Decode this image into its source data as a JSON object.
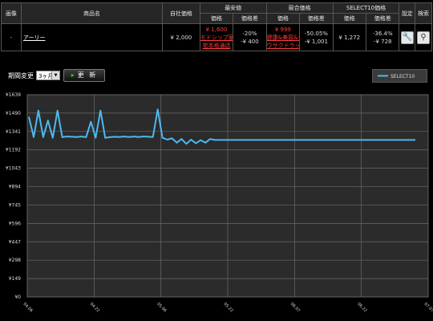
{
  "table": {
    "headers": {
      "image": "画像",
      "product": "商品名",
      "own_price": "自社価格",
      "lowest": "最安値",
      "competitor": "競合価格",
      "select10": "SELECT10価格",
      "settings": "設定",
      "search": "検索",
      "price": "価格",
      "price_diff": "価格差"
    },
    "row": {
      "image": "-",
      "product_name": "アーリー",
      "own_price": "¥ 2,000",
      "lowest_price": "¥ 1,600",
      "lowest_shop": "モドシップ家",
      "lowest_shop2": "宅本格通店",
      "lowest_diff_pct": "-20%",
      "lowest_diff_amt": "-¥ 400",
      "comp_price": "¥ 999",
      "comp_shop": "健康&美容&サ",
      "comp_shop2": "ウサクドラッグ",
      "comp_diff_pct": "-50.05%",
      "comp_diff_amt": "-¥ 1,001",
      "s10_price": "¥ 1,272",
      "s10_diff_pct": "-36.4%",
      "s10_diff_amt": "-¥ 728",
      "settings_icon": "wrench-icon",
      "search_icon": "magnifier-icon"
    }
  },
  "period": {
    "label": "期間変更",
    "selected": "3ヶ月",
    "update_label": "更 新"
  },
  "chart_data": {
    "type": "line",
    "y_ticks": [
      "¥1639",
      "¥1490",
      "¥1341",
      "¥1192",
      "¥1043",
      "¥894",
      "¥745",
      "¥596",
      "¥447",
      "¥298",
      "¥149",
      "¥0"
    ],
    "ylim": [
      0,
      1639
    ],
    "x_ticks": [
      "04.06",
      "04.22",
      "05.06",
      "05.22",
      "06.07",
      "06.22",
      "07.07"
    ],
    "legend": "SELECT10",
    "series": [
      {
        "name": "SELECT10",
        "color": "#4db8f0",
        "values": [
          1460,
          1295,
          1510,
          1295,
          1430,
          1290,
          1510,
          1295,
          1300,
          1298,
          1296,
          1300,
          1295,
          1420,
          1290,
          1510,
          1290,
          1295,
          1298,
          1296,
          1300,
          1296,
          1300,
          1296,
          1300,
          1298,
          1296,
          1520,
          1290,
          1275,
          1285,
          1250,
          1280,
          1240,
          1275,
          1245,
          1270,
          1250,
          1280,
          1272,
          1272,
          1272,
          1272,
          1272,
          1272,
          1272,
          1272,
          1272,
          1272,
          1272,
          1272,
          1272,
          1272,
          1272,
          1272,
          1272,
          1272,
          1272,
          1272,
          1272,
          1272,
          1272,
          1272,
          1272,
          1272,
          1272,
          1272,
          1272,
          1272,
          1272,
          1272,
          1272,
          1272,
          1272,
          1272,
          1272,
          1272,
          1272,
          1272,
          1272,
          1272,
          1272
        ]
      }
    ],
    "grid": true
  }
}
